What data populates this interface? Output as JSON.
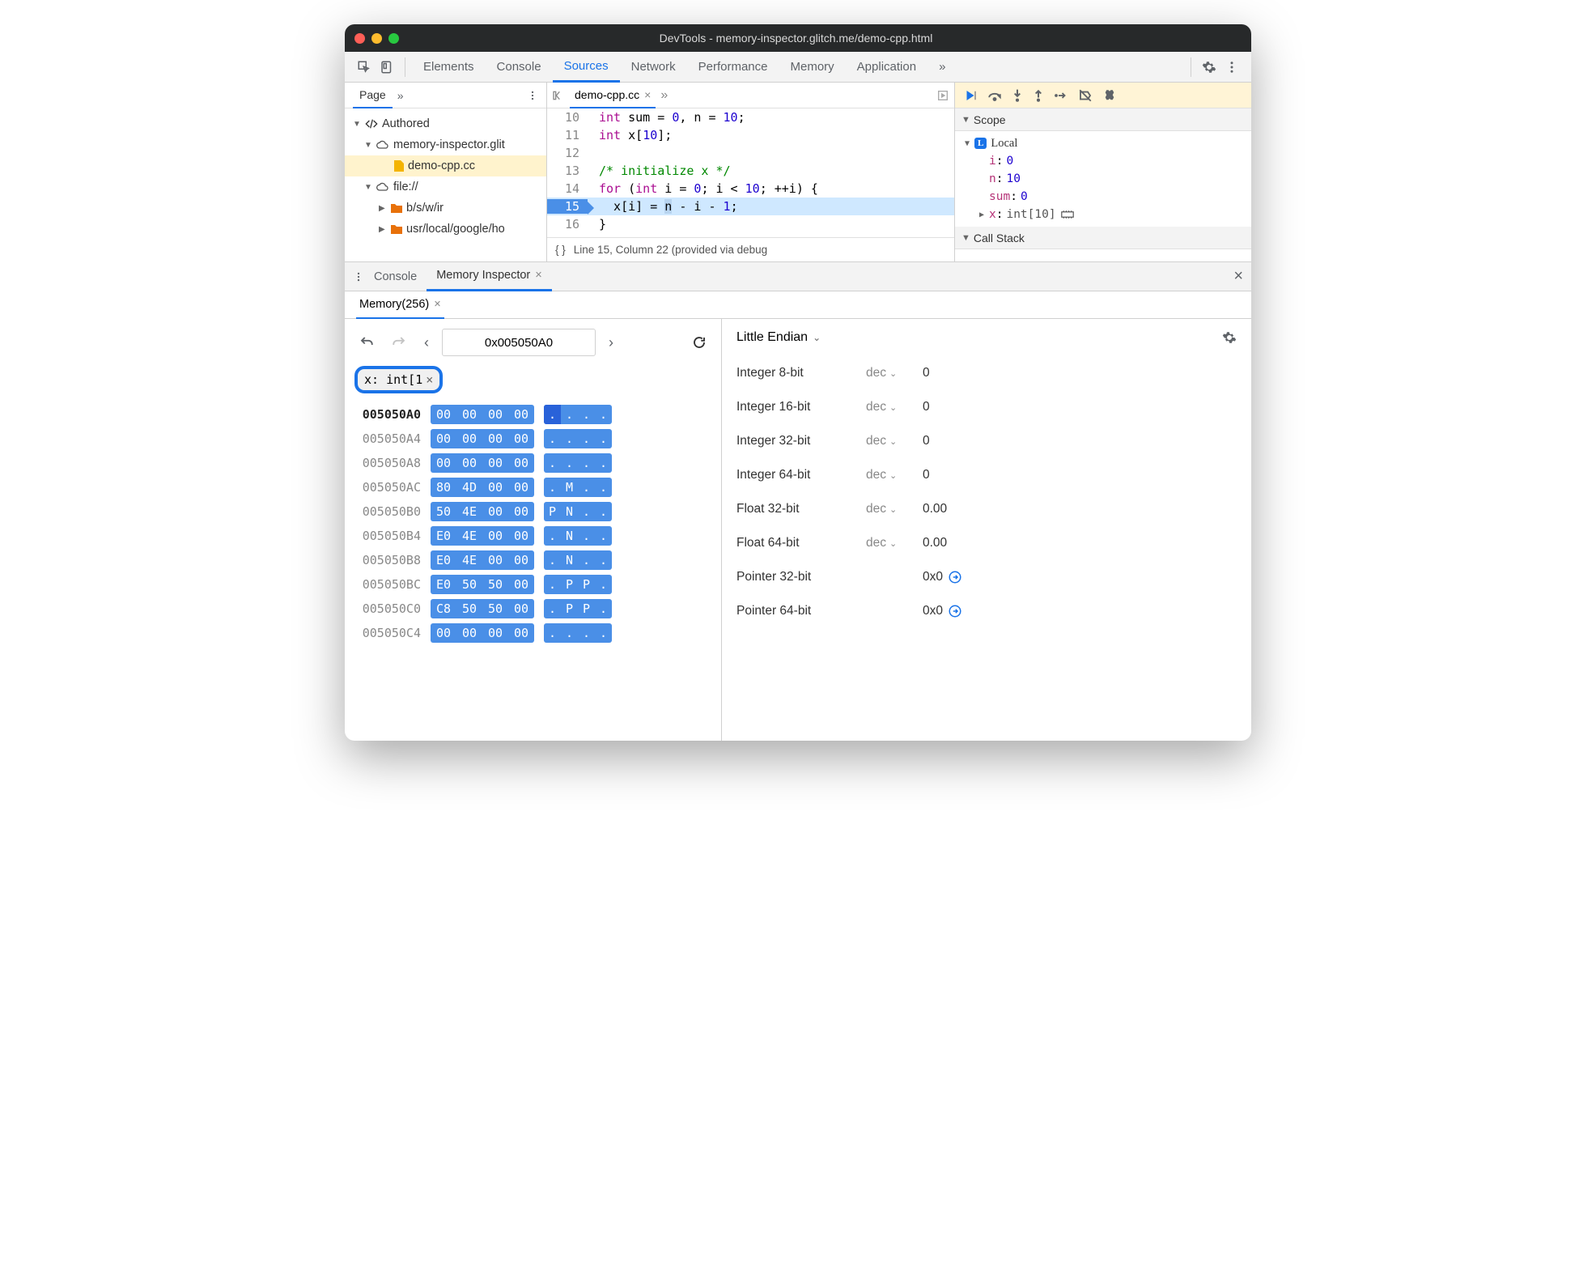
{
  "window": {
    "title": "DevTools - memory-inspector.glitch.me/demo-cpp.html"
  },
  "main_tabs": [
    "Elements",
    "Console",
    "Sources",
    "Network",
    "Performance",
    "Memory",
    "Application"
  ],
  "main_tabs_active": "Sources",
  "file_panel": {
    "page_label": "Page",
    "tree": {
      "authored": "Authored",
      "host": "memory-inspector.glit",
      "current_file": "demo-cpp.cc",
      "file_scheme": "file://",
      "folder1": "b/s/w/ir",
      "folder2": "usr/local/google/ho"
    }
  },
  "editor": {
    "tab": "demo-cpp.cc",
    "lines": [
      {
        "n": 10,
        "html": "<span class='kw'>int</span> sum = <span class='num'>0</span>, n = <span class='num'>10</span>;"
      },
      {
        "n": 11,
        "html": "<span class='kw'>int</span> x[<span class='num'>10</span>];"
      },
      {
        "n": 12,
        "html": ""
      },
      {
        "n": 13,
        "html": "<span class='cm'>/* initialize x */</span>"
      },
      {
        "n": 14,
        "html": "<span class='kw'>for</span> (<span class='kw'>int</span> i = <span class='num'>0</span>; i &lt; <span class='num'>10</span>; ++i) {"
      },
      {
        "n": 15,
        "hl": true,
        "html": "  x[i] = <span class='var-hl'>n</span> - i - <span class='num'>1</span>;"
      },
      {
        "n": 16,
        "html": "}"
      }
    ],
    "status": "Line 15, Column 22 (provided via debug"
  },
  "scope": {
    "header": "Scope",
    "local_label": "Local",
    "vars": [
      {
        "k": "i",
        "v": "0"
      },
      {
        "k": "n",
        "v": "10"
      },
      {
        "k": "sum",
        "v": "0"
      },
      {
        "k": "x",
        "t": "int[10]",
        "expandable": true,
        "mem": true
      }
    ],
    "callstack": "Call Stack"
  },
  "drawer": {
    "console_label": "Console",
    "mi_label": "Memory Inspector",
    "subtab": "Memory(256)"
  },
  "memory": {
    "address": "0x005050A0",
    "chip": "x: int[1",
    "rows": [
      {
        "addr": "005050A0",
        "bold": true,
        "bytes": [
          "00",
          "00",
          "00",
          "00"
        ],
        "ascii": [
          ".",
          ".",
          ".",
          "."
        ],
        "dk": [
          0
        ]
      },
      {
        "addr": "005050A4",
        "bytes": [
          "00",
          "00",
          "00",
          "00"
        ],
        "ascii": [
          ".",
          ".",
          ".",
          "."
        ]
      },
      {
        "addr": "005050A8",
        "bytes": [
          "00",
          "00",
          "00",
          "00"
        ],
        "ascii": [
          ".",
          ".",
          ".",
          "."
        ]
      },
      {
        "addr": "005050AC",
        "bytes": [
          "80",
          "4D",
          "00",
          "00"
        ],
        "ascii": [
          ".",
          "M",
          ".",
          "."
        ]
      },
      {
        "addr": "005050B0",
        "bytes": [
          "50",
          "4E",
          "00",
          "00"
        ],
        "ascii": [
          "P",
          "N",
          ".",
          "."
        ]
      },
      {
        "addr": "005050B4",
        "bytes": [
          "E0",
          "4E",
          "00",
          "00"
        ],
        "ascii": [
          ".",
          "N",
          ".",
          "."
        ]
      },
      {
        "addr": "005050B8",
        "bytes": [
          "E0",
          "4E",
          "00",
          "00"
        ],
        "ascii": [
          ".",
          "N",
          ".",
          "."
        ]
      },
      {
        "addr": "005050BC",
        "bytes": [
          "E0",
          "50",
          "50",
          "00"
        ],
        "ascii": [
          ".",
          "P",
          "P",
          "."
        ]
      },
      {
        "addr": "005050C0",
        "bytes": [
          "C8",
          "50",
          "50",
          "00"
        ],
        "ascii": [
          ".",
          "P",
          "P",
          "."
        ]
      },
      {
        "addr": "005050C4",
        "bytes": [
          "00",
          "00",
          "00",
          "00"
        ],
        "ascii": [
          ".",
          ".",
          ".",
          "."
        ]
      }
    ]
  },
  "interpreter": {
    "endian": "Little Endian",
    "rows": [
      {
        "label": "Integer 8-bit",
        "mode": "dec",
        "value": "0"
      },
      {
        "label": "Integer 16-bit",
        "mode": "dec",
        "value": "0"
      },
      {
        "label": "Integer 32-bit",
        "mode": "dec",
        "value": "0"
      },
      {
        "label": "Integer 64-bit",
        "mode": "dec",
        "value": "0"
      },
      {
        "label": "Float 32-bit",
        "mode": "dec",
        "value": "0.00"
      },
      {
        "label": "Float 64-bit",
        "mode": "dec",
        "value": "0.00"
      },
      {
        "label": "Pointer 32-bit",
        "mode": "",
        "value": "0x0",
        "jump": true
      },
      {
        "label": "Pointer 64-bit",
        "mode": "",
        "value": "0x0",
        "jump": true
      }
    ]
  }
}
